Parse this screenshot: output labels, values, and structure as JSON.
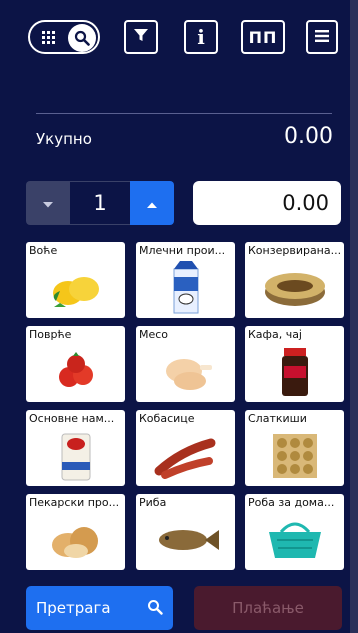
{
  "toolbar": {
    "grid_icon": "grid-icon",
    "search_icon": "search-icon",
    "filter_icon": "filter-icon",
    "info_label": "i",
    "pp_label": "ПП",
    "menu_icon": "menu-icon"
  },
  "summary": {
    "total_label": "Укупно",
    "total_value": "0.00"
  },
  "quantity": {
    "value": "1",
    "amount": "0.00"
  },
  "categories": [
    {
      "label": "Воће",
      "icon": "lemon-icon"
    },
    {
      "label": "Млечни прои...",
      "icon": "milk-carton-icon"
    },
    {
      "label": "Конзервирана...",
      "icon": "canned-food-icon"
    },
    {
      "label": "Поврће",
      "icon": "tomato-icon"
    },
    {
      "label": "Месо",
      "icon": "chicken-leg-icon"
    },
    {
      "label": "Кафа, чај",
      "icon": "coffee-jar-icon"
    },
    {
      "label": "Основне нам...",
      "icon": "flour-bag-icon"
    },
    {
      "label": "Кобасице",
      "icon": "sausage-icon"
    },
    {
      "label": "Слаткиши",
      "icon": "chocolate-box-icon"
    },
    {
      "label": "Пекарски про...",
      "icon": "bread-icon"
    },
    {
      "label": "Риба",
      "icon": "fish-icon"
    },
    {
      "label": "Роба за дома...",
      "icon": "basket-icon"
    }
  ],
  "bottom": {
    "search_label": "Претрага",
    "pay_label": "Плаћање"
  },
  "colors": {
    "background": "#0c1446",
    "accent": "#1e6ff0",
    "pay_disabled": "#4a1a2e"
  }
}
